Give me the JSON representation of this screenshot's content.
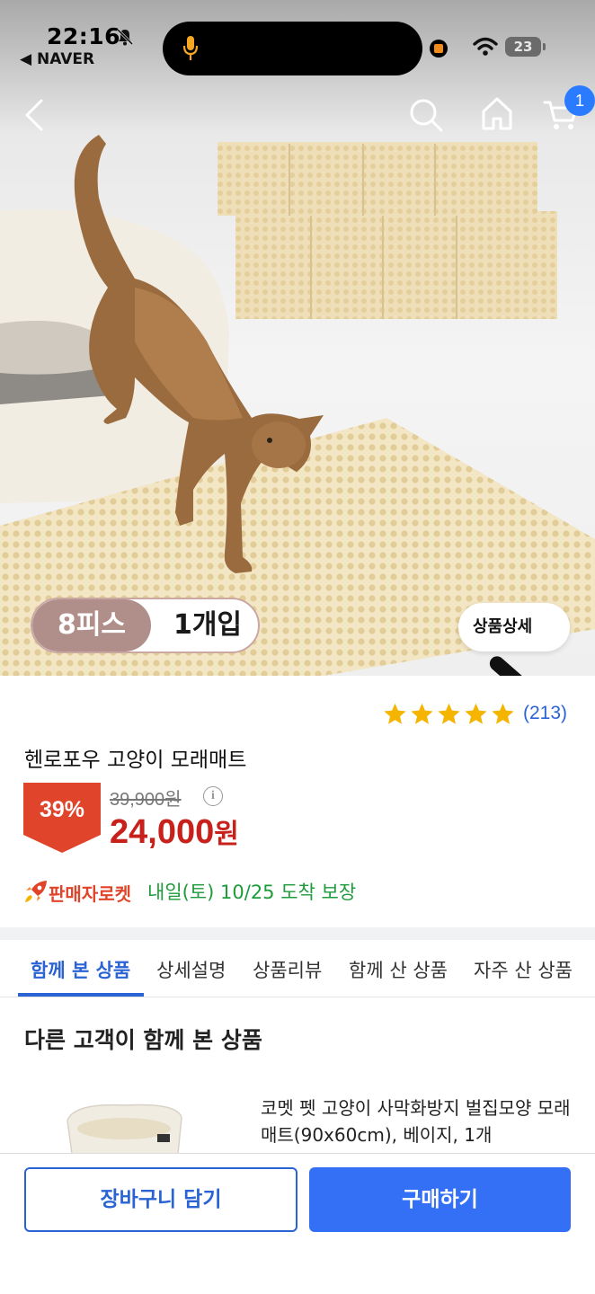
{
  "status_bar": {
    "time": "22:16",
    "back_app": "◀ NAVER",
    "battery": "23"
  },
  "nav": {
    "cart_count": "1"
  },
  "product_image": {
    "option_pieces": "8피스",
    "option_count": "1개입",
    "detail_button": "상품상세"
  },
  "product": {
    "rating_stars": 5,
    "review_count": "(213)",
    "title": "헨로포우 고양이 모래매트",
    "discount": "39%",
    "original_price": "39,900원",
    "price_number": "24,000",
    "price_unit": "원",
    "info_icon": "i",
    "rocket_label": "판매자로켓",
    "delivery": "내일(토) 10/25 도착 보장"
  },
  "tabs": [
    {
      "label": "함께 본 상품",
      "active": true
    },
    {
      "label": "상세설명"
    },
    {
      "label": "상품리뷰"
    },
    {
      "label": "함께 산 상품"
    },
    {
      "label": "자주 산 상품"
    }
  ],
  "recommend": {
    "section_title": "다른 고객이 함께 본 상품",
    "item_name": "코멧 펫 고양이 사막화방지 벌집모양 모래매트(90x60cm), 베이지, 1개"
  },
  "bottom": {
    "cart_button": "장바구니 담기",
    "buy_button": "구매하기"
  },
  "colors": {
    "accent_blue": "#2a63d4",
    "buy_button": "#3470f6",
    "price_red": "#c8201b",
    "delivery_green": "#1e9b3a",
    "star": "#f5b400",
    "option_chip": "#b08f8b"
  }
}
